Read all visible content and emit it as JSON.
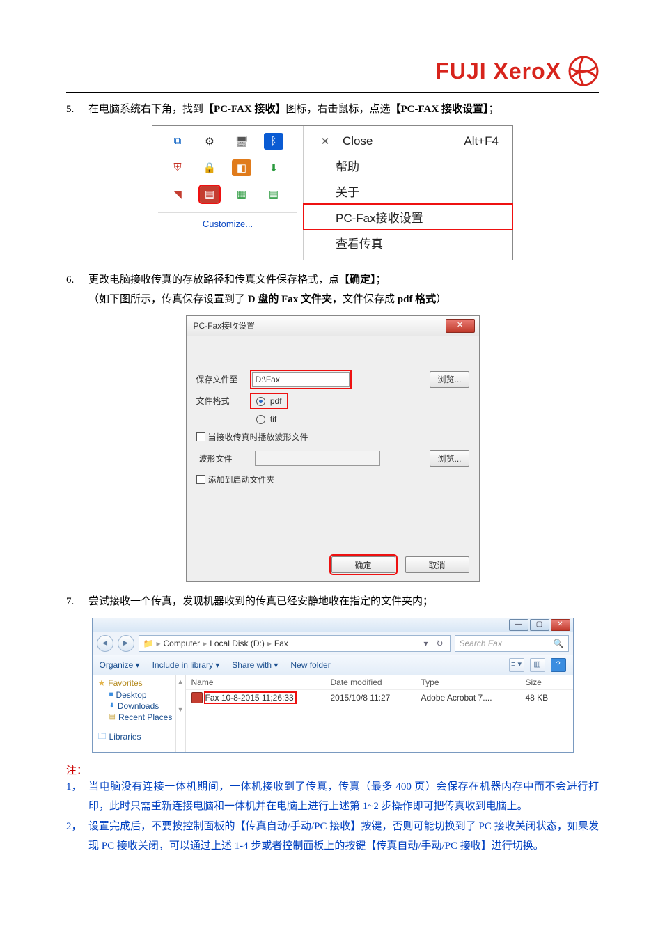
{
  "logo": {
    "text": "FUJI XeroX"
  },
  "step5": {
    "num": "5.",
    "t1": "在电脑系统右下角，找到",
    "b1": "【PC-FAX 接收】",
    "t2": "图标，右击鼠标，点选",
    "b2": "【PC-FAX 接收设置】",
    "t3": "；"
  },
  "fig1": {
    "customize": "Customize...",
    "close": "Close",
    "close_key": "Alt+F4",
    "help": "帮助",
    "about": "关于",
    "settings": "PC-Fax接收设置",
    "view": "查看传真"
  },
  "step6": {
    "num": "6.",
    "line1_a": "更改电脑接收传真的存放路径和传真文件保存格式，点",
    "line1_b": "【确定】",
    "line1_c": "；",
    "line2_a": "（如下图所示，传真保存设置到了",
    "line2_b": " D 盘的 Fax 文件夹",
    "line2_c": "，文件保存成",
    "line2_d": " pdf 格式",
    "line2_e": "）"
  },
  "fig2": {
    "title": "PC-Fax接收设置",
    "save_label": "保存文件至",
    "save_path": "D:\\Fax",
    "browse": "浏览...",
    "format_label": "文件格式",
    "fmt_pdf": "pdf",
    "fmt_tif": "tif",
    "play_wave": "当接收传真时播放波形文件",
    "wave_label": "波形文件",
    "add_startup": "添加到启动文件夹",
    "ok": "确定",
    "cancel": "取消"
  },
  "step7": {
    "num": "7.",
    "text": "尝试接收一个传真，发现机器收到的传真已经安静地收在指定的文件夹内；"
  },
  "fig3": {
    "crumbs": [
      "Computer",
      "Local Disk (D:)",
      "Fax"
    ],
    "refresh": "↻",
    "search_ph": "Search Fax",
    "tb": {
      "organize": "Organize ▾",
      "include": "Include in library ▾",
      "share": "Share with ▾",
      "newf": "New folder"
    },
    "cols": {
      "name": "Name",
      "date": "Date modified",
      "type": "Type",
      "size": "Size"
    },
    "row": {
      "name": "Fax 10-8-2015 11;26;33",
      "date": "2015/10/8 11:27",
      "type": "Adobe Acrobat 7....",
      "size": "48 KB"
    },
    "fav_head": "Favorites",
    "fav": [
      "Desktop",
      "Downloads",
      "Recent Places"
    ],
    "libraries": "Libraries"
  },
  "notes": {
    "head": "注：",
    "n1_num": "1，",
    "n1": "当电脑没有连接一体机期间，一体机接收到了传真，传真（最多 400 页）会保存在机器内存中而不会进行打印，此时只需重新连接电脑和一体机并在电脑上进行上述第 1~2 步操作即可把传真收到电脑上。",
    "n2_num": "2，",
    "n2": "设置完成后，不要按控制面板的【传真自动/手动/PC 接收】按键，否则可能切换到了 PC 接收关闭状态，如果发现 PC 接收关闭，可以通过上述 1-4 步或者控制面板上的按键【传真自动/手动/PC 接收】进行切换。"
  }
}
